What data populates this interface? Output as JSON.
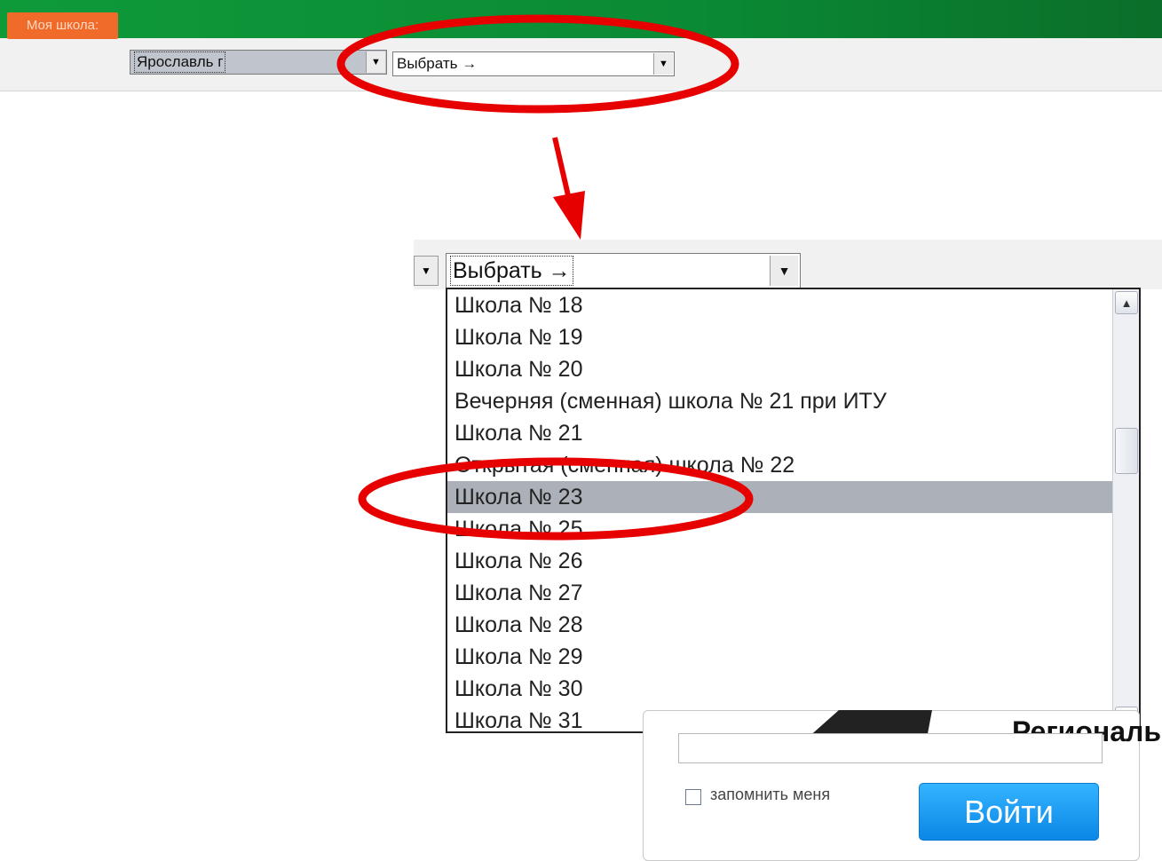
{
  "toolbar": {
    "my_school_label": "Моя школа:",
    "city_value": "Ярославль г",
    "school_select_value": "Выбрать →"
  },
  "zoomed": {
    "select_value": "Выбрать →",
    "options": [
      "Школа № 18",
      "Школа № 19",
      "Школа № 20",
      "Вечерняя (сменная) школа № 21 при ИТУ",
      "Школа № 21",
      "Открытая (сменная) школа № 22",
      "Школа № 23",
      "Школа № 25",
      "Школа № 26",
      "Школа № 27",
      "Школа № 28",
      "Школа № 29",
      "Школа № 30",
      "Школа № 31"
    ],
    "selected_option": "Школа № 23"
  },
  "login": {
    "region_title": "Региональ",
    "remember_label": "запомнить меня",
    "login_button": "Войти"
  },
  "icons": {
    "dropdown_arrow": "chevron-down-icon",
    "scroll_up": "chevron-up-icon",
    "scroll_down": "chevron-down-icon"
  },
  "colors": {
    "banner_green": "#0f9a3a",
    "badge_orange": "#f06a2a",
    "highlight_gray": "#acb0b8",
    "annotation_red": "#e60000",
    "login_blue": "#1a98f0"
  }
}
